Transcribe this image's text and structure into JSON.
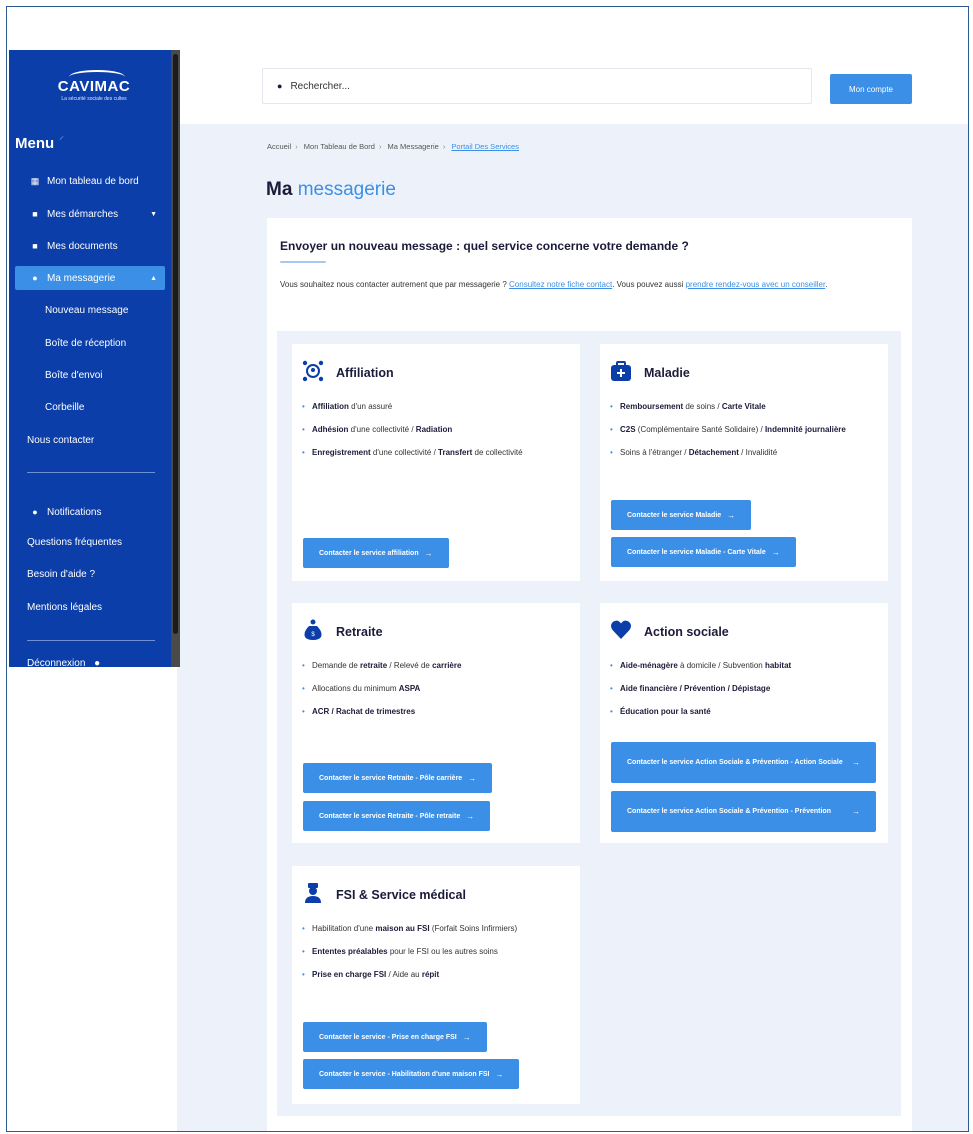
{
  "sidebar": {
    "logo_main": "CAVIMAC",
    "logo_sub": "La sécurité sociale des cultes",
    "menu_title": "Menu",
    "items": [
      {
        "label": "Mon tableau de bord",
        "icon": "grid-icon"
      },
      {
        "label": "Mes démarches",
        "icon": "folder-icon"
      },
      {
        "label": "Mes documents",
        "icon": "document-icon"
      },
      {
        "label": "Ma messagerie",
        "icon": "message-icon"
      }
    ],
    "sub_items": [
      "Nouveau message",
      "Boîte de réception",
      "Boîte d'envoi",
      "Corbeille"
    ],
    "contact": "Nous contacter",
    "notifications": "Notifications",
    "faq": "Questions fréquentes",
    "help": "Besoin d'aide ?",
    "legal": "Mentions légales",
    "logout": "Déconnexion"
  },
  "header": {
    "search_placeholder": "Rechercher...",
    "account_button": "Mon compte"
  },
  "breadcrumb": [
    "Accueil",
    "Mon Tableau de Bord",
    "Ma Messagerie",
    "Portail Des Services"
  ],
  "page_title": {
    "part1": "Ma",
    "part2": "messagerie"
  },
  "panel": {
    "heading": "Envoyer un nouveau message : quel service concerne votre demande ?",
    "intro_1": "Vous souhaitez nous contacter autrement que par messagerie ? ",
    "intro_link_1": "Consultez notre fiche contact",
    "intro_2": ". Vous pouvez aussi ",
    "intro_link_2": "prendre rendez-vous avec un conseiller",
    "intro_3": "."
  },
  "cards": {
    "affiliation": {
      "title": "Affiliation",
      "b1a": "Affiliation",
      "b1b": " d'un assuré",
      "b2a": "Adhésion",
      "b2b": " d'une collectivité / ",
      "b2c": "Radiation",
      "b3a": "Enregistrement",
      "b3b": " d'une collectivité / ",
      "b3c": "Transfert",
      "b3d": " de collectivité",
      "btn1": "Contacter le service affiliation"
    },
    "maladie": {
      "title": "Maladie",
      "b1a": "Remboursement",
      "b1b": " de soins / ",
      "b1c": "Carte Vitale",
      "b2a": "C2S",
      "b2b": " (Complémentaire Santé Solidaire) / ",
      "b2c": "Indemnité journalière",
      "b3a": "Soins à l'étranger / ",
      "b3b": "Détachement",
      "b3c": " / Invalidité",
      "btn1": "Contacter le service Maladie",
      "btn2": "Contacter le service Maladie - Carte Vitale"
    },
    "retraite": {
      "title": "Retraite",
      "b1a": "Demande de ",
      "b1b": "retraite",
      "b1c": " / Relevé de ",
      "b1d": "carrière",
      "b2a": "Allocations du minimum ",
      "b2b": "ASPA",
      "b3a": "ACR / Rachat de trimestres",
      "btn1": "Contacter le service Retraite - Pôle carrière",
      "btn2": "Contacter le service Retraite - Pôle retraite"
    },
    "social": {
      "title": "Action sociale",
      "b1a": "Aide-ménagère",
      "b1b": " à domicile / Subvention ",
      "b1c": "habitat",
      "b2a": "Aide financière / Prévention / Dépistage",
      "b3a": "Éducation pour la santé",
      "btn1": "Contacter le service Action Sociale & Prévention - Action Sociale",
      "btn2": "Contacter le service Action Sociale & Prévention - Prévention"
    },
    "fsi": {
      "title": "FSI & Service médical",
      "b1a": "Habilitation d'une ",
      "b1b": "maison au FSI",
      "b1c": " (Forfait Soins Infirmiers)",
      "b2a": "Ententes préalables",
      "b2b": " pour le FSI ou les autres soins",
      "b3a": "Prise en charge FSI",
      "b3b": " / Aide au ",
      "b3c": "répit",
      "btn1": "Contacter le service - Prise en charge FSI",
      "btn2": "Contacter le service - Habilitation d'une maison FSI"
    }
  },
  "colors": {
    "sidebar": "#0b3ea8",
    "accent": "#3b8fe6",
    "background": "#edf2fa"
  }
}
